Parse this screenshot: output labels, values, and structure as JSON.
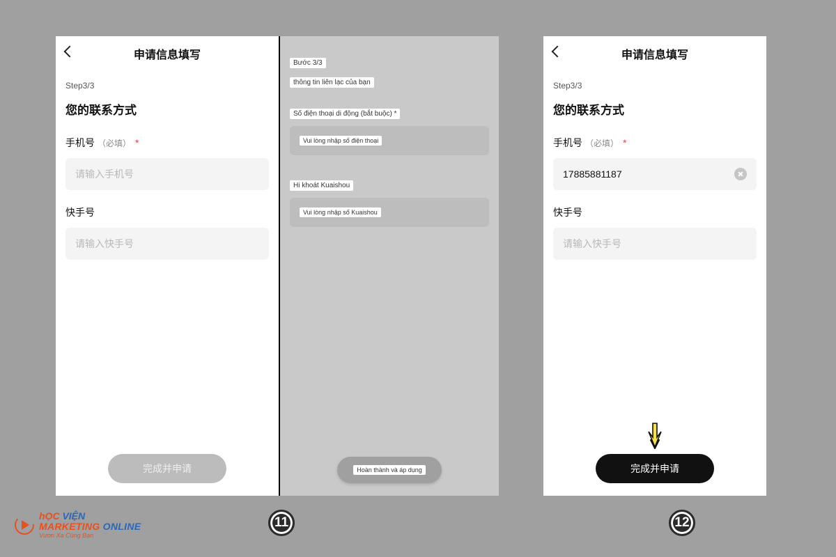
{
  "screens": {
    "left": {
      "header_title": "申请信息填写",
      "step": "Step3/3",
      "section_title": "您的联系方式",
      "phone_label": "手机号",
      "phone_hint": "（必填）",
      "phone_placeholder": "请输入手机号",
      "kuaishou_label": "快手号",
      "kuaishou_placeholder": "请输入快手号",
      "submit": "完成并申请"
    },
    "middle": {
      "step": "Bước 3/3",
      "section_title": "thông tin liên lạc của bạn",
      "phone_label": "Số điện thoại di động (bắt buộc) *",
      "phone_placeholder": "Vui lòng nhập số điện thoại",
      "kuaishou_label": "Hi khoát Kuaishou",
      "kuaishou_placeholder": "Vui lòng nhập số Kuaishou",
      "submit": "Hoàn thành và áp dụng"
    },
    "right": {
      "header_title": "申请信息填写",
      "step": "Step3/3",
      "section_title": "您的联系方式",
      "phone_label": "手机号",
      "phone_hint": "（必填）",
      "phone_value": "17885881187",
      "kuaishou_label": "快手号",
      "kuaishou_placeholder": "请输入快手号",
      "submit": "完成并申请"
    }
  },
  "step_numbers": {
    "eleven": "11",
    "twelve": "12"
  },
  "logo": {
    "line1a": "hỌC",
    "line1b": "VIỆN",
    "line2a": "MARKETING ",
    "line2b": "ONLINE",
    "tagline": "Vươn Xa Cùng Bạn"
  }
}
